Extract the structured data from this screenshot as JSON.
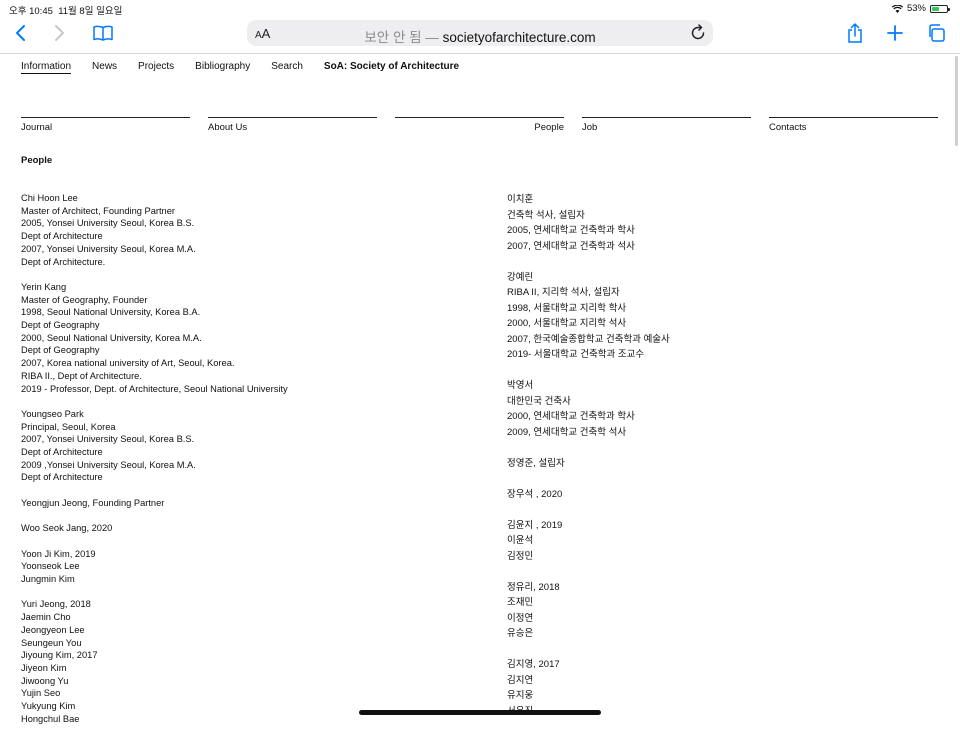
{
  "status": {
    "time": "오후 10:45",
    "date": "11월 8일 일요일",
    "battery_pct": "53%",
    "battery_level": 0.53
  },
  "browser": {
    "aa_label": "AA",
    "url_prefix": "보안 안 됨 —",
    "url_domain": "societyofarchitecture.com",
    "icons": [
      "back-icon",
      "forward-icon",
      "bookmarks-icon",
      "text-size-icon",
      "reload-icon",
      "share-icon",
      "new-tab-icon",
      "tabs-icon"
    ]
  },
  "nav": [
    "Information",
    "News",
    "Projects",
    "Bibliography",
    "Search",
    "SoA: Society of Architecture"
  ],
  "categories": [
    "Journal",
    "About Us",
    "People",
    "Job",
    "Contacts"
  ],
  "section_title": "People",
  "english": [
    [
      "Chi Hoon Lee",
      "Master of Architect, Founding Partner",
      "2005, Yonsei University Seoul, Korea B.S.",
      "Dept of Architecture",
      "2007, Yonsei University Seoul, Korea M.A.",
      "Dept of Architecture."
    ],
    [
      "Yerin Kang",
      "Master of Geography, Founder",
      "1998, Seoul National University, Korea B.A.",
      "Dept of Geography",
      "2000, Seoul National University, Korea M.A.",
      "Dept of Geography",
      "2007, Korea national university of Art, Seoul, Korea.",
      "RIBA II., Dept of Architecture.",
      "2019 - Professor, Dept. of Architecture, Seoul National University"
    ],
    [
      "Youngseo Park",
      "Principal, Seoul, Korea",
      "2007, Yonsei University Seoul, Korea B.S.",
      "Dept of Architecture",
      "2009 ,Yonsei University Seoul, Korea M.A.",
      "Dept of Architecture"
    ],
    [
      "Yeongjun Jeong, Founding Partner"
    ],
    [
      "Woo Seok Jang, 2020"
    ],
    [
      "Yoon Ji Kim, 2019",
      "Yoonseok Lee",
      "Jungmin Kim"
    ],
    [
      "Yuri Jeong, 2018",
      "Jaemin Cho",
      "Jeongyeon Lee",
      "Seungeun You",
      "Jiyoung Kim, 2017",
      "Jiyeon Kim",
      "Jiwoong Yu",
      "Yujin Seo",
      "Yukyung Kim",
      "Hongchul Bae"
    ]
  ],
  "korean": [
    [
      "이치훈",
      "건축학 석사, 설립자",
      "2005, 연세대학교 건축학과 학사",
      "2007, 연세대학교 건축학과 석사"
    ],
    [
      "강예린",
      "RIBA II, 지리학 석사, 설립자",
      "1998, 서울대학교 지리학 학사",
      "2000, 서울대학교 지리학 석사",
      "2007, 한국예술종합학교 건축학과 예술사",
      "2019- 서울대학교 건축학과 조교수"
    ],
    [
      "박영서",
      "대한민국 건축사",
      "2000, 연세대학교 건축학과 학사",
      "2009, 연세대학교 건축학 석사"
    ],
    [
      "정영준, 설립자"
    ],
    [
      "장우석 , 2020"
    ],
    [
      "김윤지 , 2019",
      "이윤석",
      "김정민"
    ],
    [
      "정유리, 2018",
      "조재민",
      "이정연",
      "유승은"
    ],
    [
      "김지영, 2017",
      "김지연",
      "유지웅",
      "서유진"
    ]
  ]
}
